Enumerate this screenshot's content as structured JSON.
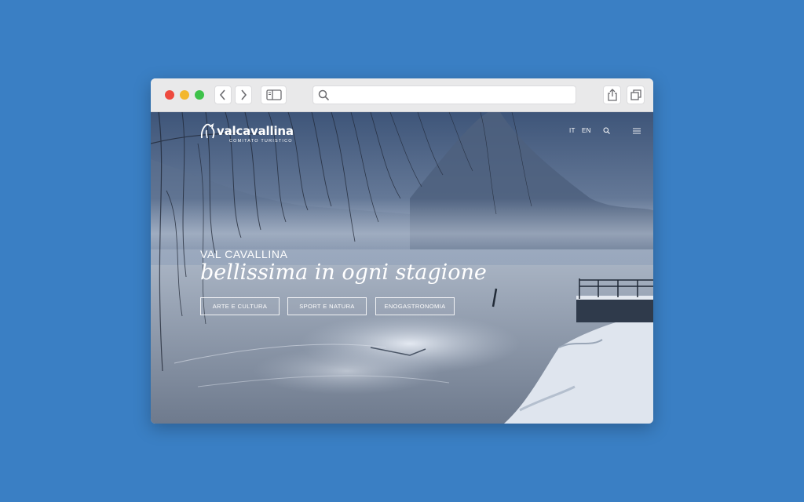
{
  "browser": {
    "back_icon": "chevron-left-icon",
    "forward_icon": "chevron-right-icon",
    "sidebar_icon": "sidebar-icon",
    "search_icon": "search-icon",
    "url_value": "",
    "share_icon": "share-icon",
    "tabs_icon": "tabs-icon"
  },
  "site": {
    "logo_name": "valcavallina",
    "logo_tagline": "COMITATO TURISTICO",
    "languages": [
      "IT",
      "EN"
    ],
    "search_icon": "search-icon",
    "menu_icon": "hamburger-menu-icon"
  },
  "hero": {
    "kicker": "VAL CAVALLINA",
    "title": "bellissima in ogni stagione",
    "buttons": [
      "ARTE E CULTURA",
      "SPORT E NATURA",
      "ENOGASTRONOMIA"
    ]
  },
  "colors": {
    "page_background": "#3a7fc4",
    "hero_text": "#ffffff"
  }
}
